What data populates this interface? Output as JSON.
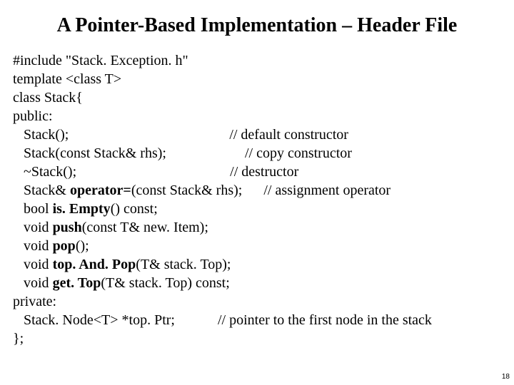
{
  "title": "A Pointer-Based Implementation – Header File",
  "code": {
    "l1": "#include \"Stack. Exception. h\"",
    "l2_a": "template <class T>",
    "l3": "class Stack{",
    "l4": "public:",
    "l5": "   Stack();",
    "l5c": "// default constructor",
    "l6": "   Stack(const Stack& rhs);",
    "l6c": "// copy constructor",
    "l7": "   ~Stack();",
    "l7c": "// destructor",
    "l8a": "   Stack& ",
    "l8b": "operator=",
    "l8c": "(const Stack& rhs);",
    "l8d": "// assignment operator",
    "l9a": "   bool ",
    "l9b": "is. Empty",
    "l9c": "() const;",
    "l10a": "   void ",
    "l10b": "push",
    "l10c": "(const T& new. Item);",
    "l11a": "   void ",
    "l11b": "pop",
    "l11c": "();",
    "l12a": "   void ",
    "l12b": "top. And. Pop",
    "l12c": "(T& stack. Top);",
    "l13a": "   void ",
    "l13b": "get. Top",
    "l13c": "(T& stack. Top) const;",
    "l14": "private:",
    "l15a": "   Stack. Node<T> *top. Ptr;",
    "l15b": "// pointer to the first node in the stack",
    "l16": "};"
  },
  "page_number": "18"
}
